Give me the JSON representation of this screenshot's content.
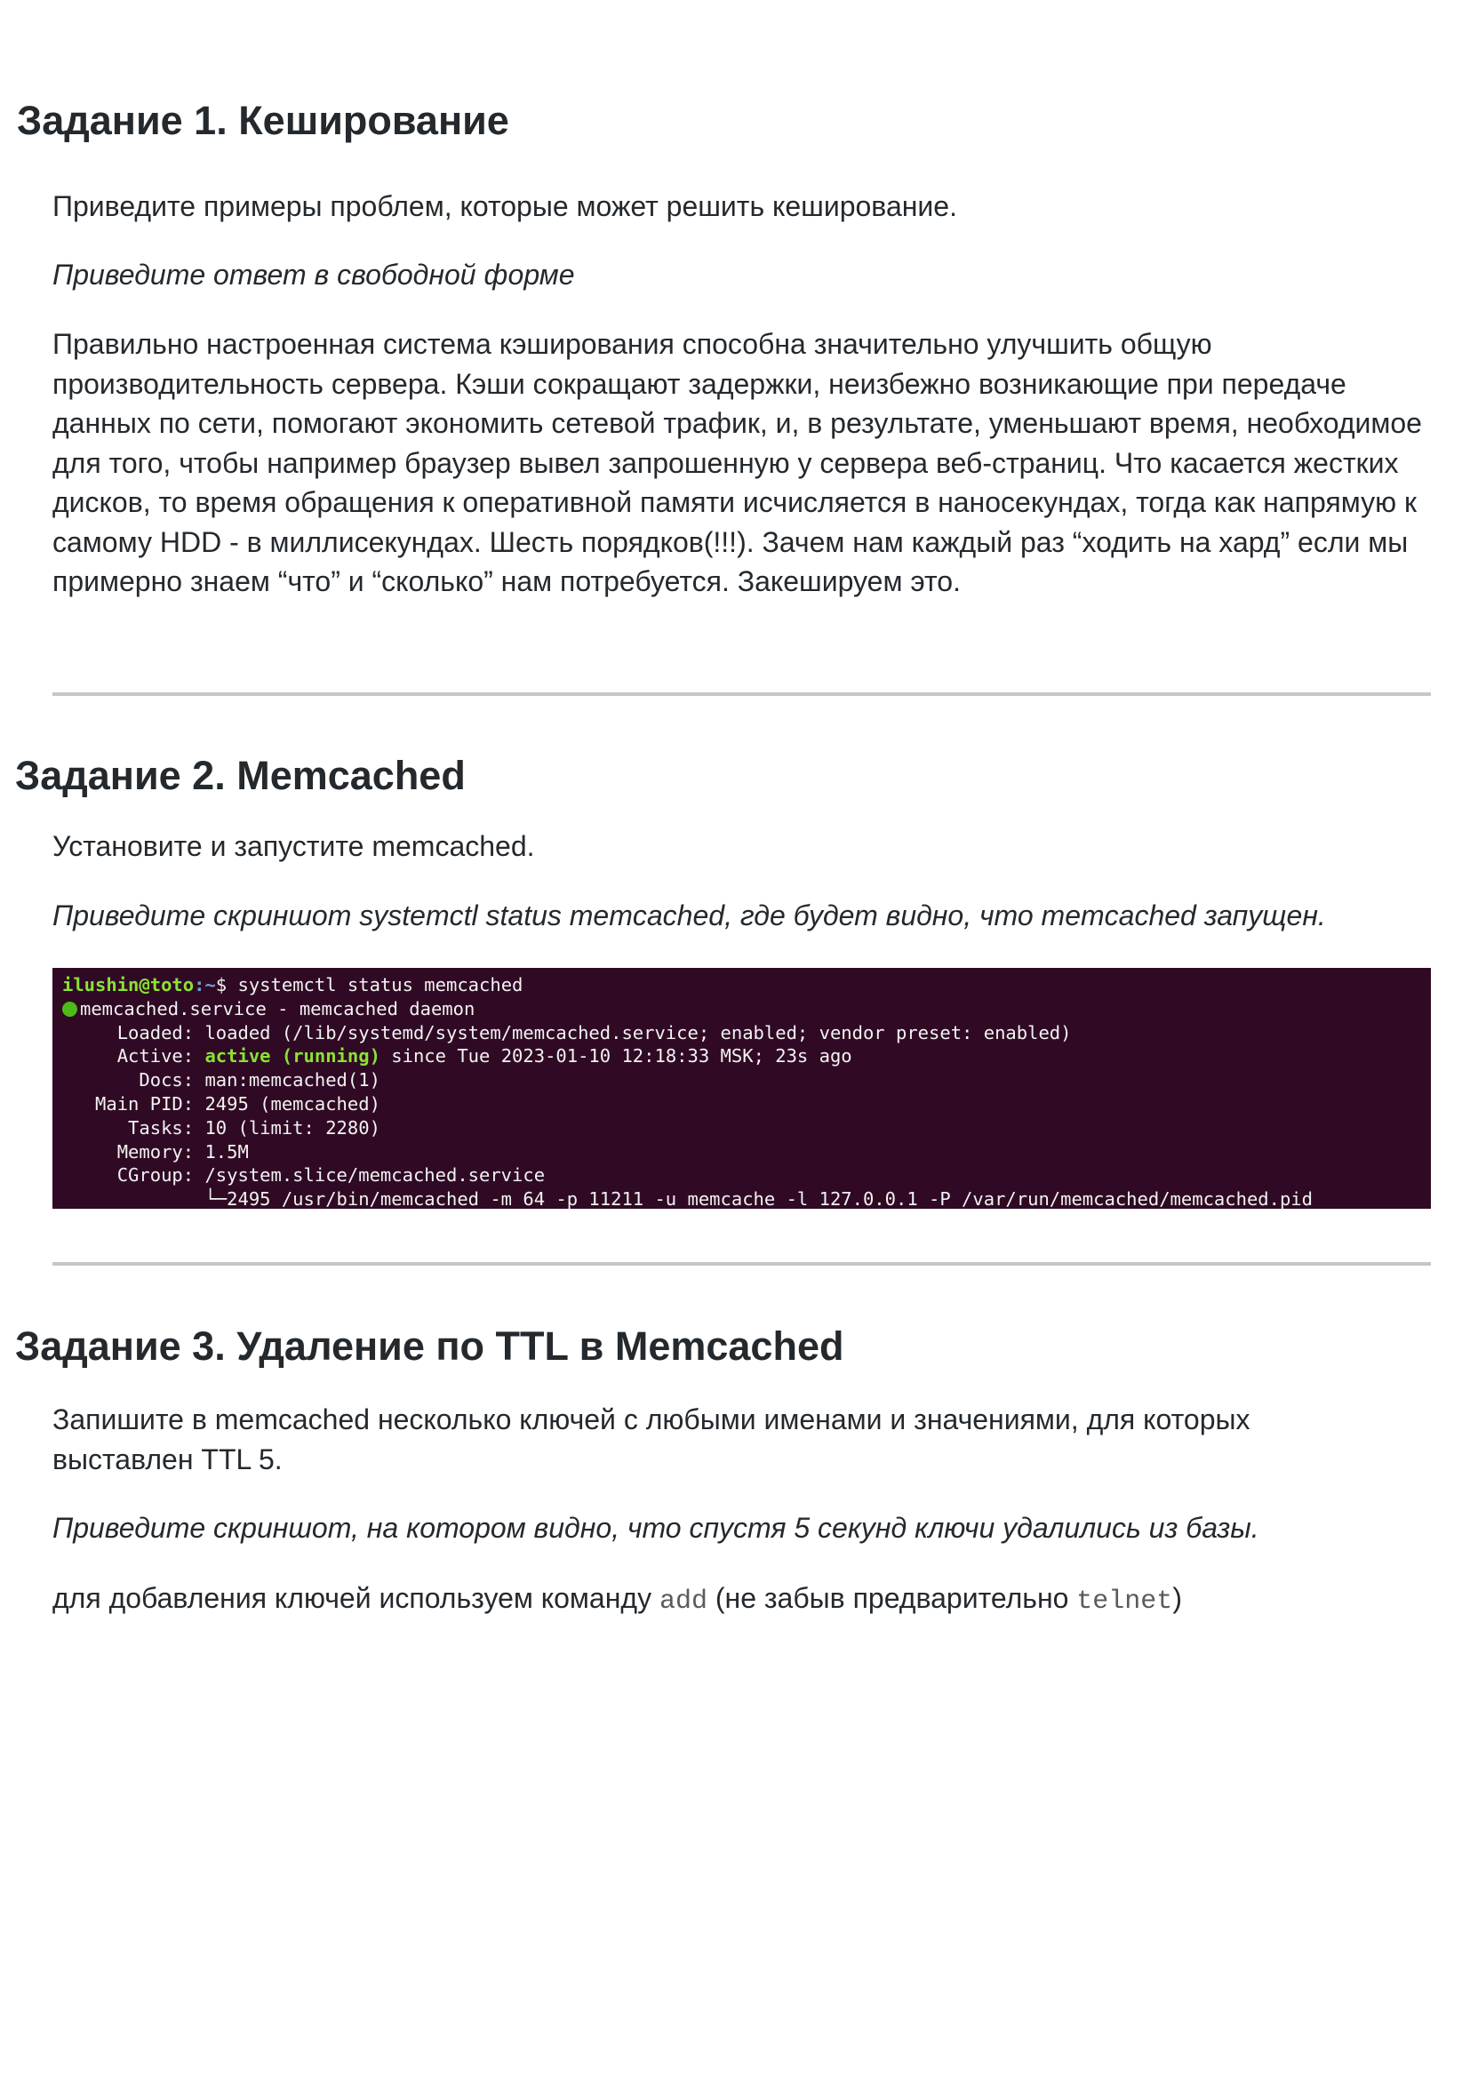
{
  "task1": {
    "title": "Задание 1. Кеширование",
    "question": "Приведите примеры проблем, которые может решить кеширование.",
    "instruction": "Приведите ответ в свободной форме",
    "answer": "Правильно настроенная система кэширования способна значительно улучшить общую производительность сервера. Кэши сокращают задержки, неизбежно возникающие при передаче данных по сети, помогают экономить сетевой трафик, и, в результате, уменьшают время, необходимое для того, чтобы например браузер вывел запрошенную у сервера веб-страниц. Что касается жестких дисков, то время обращения к оперативной памяти исчисляется в наносекундах, тогда как напрямую к самому HDD - в миллисекундах. Шесть порядков(!!!). Зачем нам каждый раз “ходить на хард” если мы примерно знаем “что” и “сколько” нам потребуется. Закешируем это."
  },
  "task2": {
    "title": "Задание 2. Memcached",
    "question": "Установите и запустите memcached.",
    "instruction": "Приведите скриншот systemctl status memcached, где будет видно, что memcached запущен.",
    "terminal": {
      "prompt_user": "ilushin@toto",
      "prompt_path": ":~",
      "prompt_rest": "$ systemctl status memcached",
      "service_line": "memcached.service - memcached daemon",
      "loaded": "     Loaded: loaded (/lib/systemd/system/memcached.service; enabled; vendor preset: enabled)",
      "active_label": "     Active: ",
      "active_state": "active (running)",
      "active_rest": " since Tue 2023-01-10 12:18:33 MSK; 23s ago",
      "docs": "       Docs: man:memcached(1)",
      "main_pid": "   Main PID: 2495 (memcached)",
      "tasks": "      Tasks: 10 (limit: 2280)",
      "memory": "     Memory: 1.5M",
      "cgroup": "     CGroup: /system.slice/memcached.service",
      "process": "             └─2495 /usr/bin/memcached -m 64 -p 11211 -u memcache -l 127.0.0.1 -P /var/run/memcached/memcached.pid"
    }
  },
  "task3": {
    "title": "Задание 3. Удаление по TTL в Memcached",
    "question": "Запишите в memcached несколько ключей с любыми именами и значениями, для которых выставлен TTL 5.",
    "instruction": "Приведите скриншот, на котором видно, что спустя 5 секунд ключи удалились из базы.",
    "answer_prefix": "для добавления ключей используем команду ",
    "answer_code1": "add",
    "answer_middle": " (не забыв предварительно ",
    "answer_code2": "telnet",
    "answer_suffix": ")"
  }
}
